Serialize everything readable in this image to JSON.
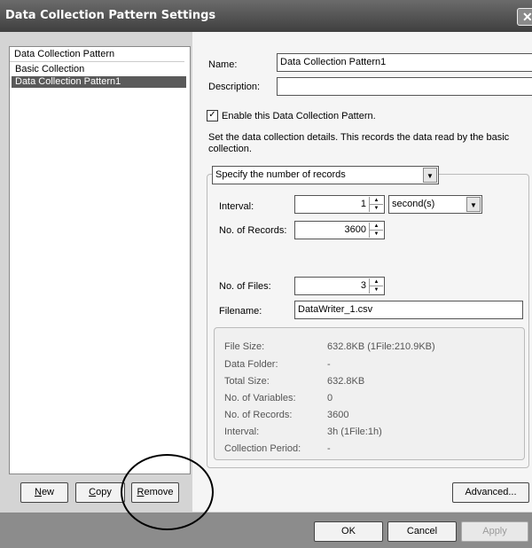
{
  "window": {
    "title": "Data Collection Pattern Settings",
    "close_glyph": "✕"
  },
  "pattern_list": {
    "header": "Data Collection Pattern",
    "items": [
      {
        "label": "Basic Collection",
        "selected": false
      },
      {
        "label": "Data Collection Pattern1",
        "selected": true
      }
    ]
  },
  "left_buttons": {
    "new": "New",
    "copy": "Copy",
    "remove": "Remove"
  },
  "form": {
    "name_label": "Name:",
    "name_value": "Data Collection Pattern1",
    "description_label": "Description:",
    "description_value": "",
    "enable_label": "Enable this Data Collection Pattern.",
    "enable_checked": true,
    "hint": "Set the data collection details. This records the data read by the basic collection.",
    "mode_value": "Specify the number of records",
    "interval_label": "Interval:",
    "interval_value": "1",
    "interval_unit": "second(s)",
    "records_label": "No. of Records:",
    "records_value": "3600",
    "files_label": "No. of Files:",
    "files_value": "3",
    "filename_label": "Filename:",
    "filename_value": "DataWriter_1.csv"
  },
  "summary": [
    {
      "key": "File Size:",
      "value": "632.8KB (1File:210.9KB)"
    },
    {
      "key": "Data Folder:",
      "value": "-"
    },
    {
      "key": "Total Size:",
      "value": "632.8KB"
    },
    {
      "key": "No. of Variables:",
      "value": "0"
    },
    {
      "key": "No. of Records:",
      "value": "3600"
    },
    {
      "key": "Interval:",
      "value": "3h (1File:1h)"
    },
    {
      "key": "Collection Period:",
      "value": "-"
    }
  ],
  "advanced_button": "Advanced...",
  "dialog_buttons": {
    "ok": "OK",
    "cancel": "Cancel",
    "apply": "Apply"
  }
}
